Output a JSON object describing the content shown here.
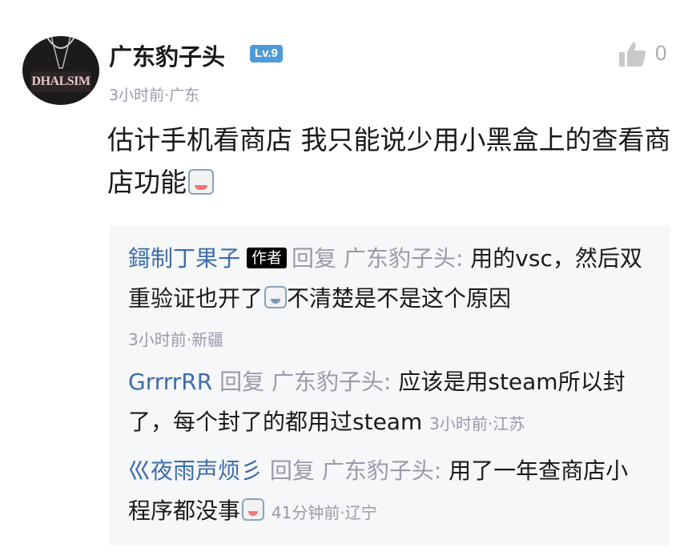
{
  "comment": {
    "avatar_text": "DHALSIM",
    "username": "广东豹子头",
    "level": "Lv.9",
    "like_count": "0",
    "meta": "3小时前·广东",
    "text": "估计手机看商店 我只能说少用小黑盒上的查看商店功能",
    "emoji": "grinning-sticker"
  },
  "replies": [
    {
      "user": "鎶制丁果子",
      "author_tag": "作者",
      "verb": "回复",
      "target": "广东豹子头:",
      "text_part1": " 用的vsc，然后双重验证也开了",
      "text_part2": "不清楚是不是这个原因",
      "meta": "3小时前·新疆"
    },
    {
      "user": "GrrrrRR",
      "verb": "回复",
      "target": "广东豹子头:",
      "text": " 应该是用steam所以封了，每个封了的都用过steam",
      "meta": "3小时前·江苏"
    },
    {
      "user": "巛夜雨声烦彡",
      "verb": "回复",
      "target": "广东豹子头:",
      "text": " 用了一年查商店小程序都没事",
      "meta": "41分钟前·辽宁"
    }
  ]
}
